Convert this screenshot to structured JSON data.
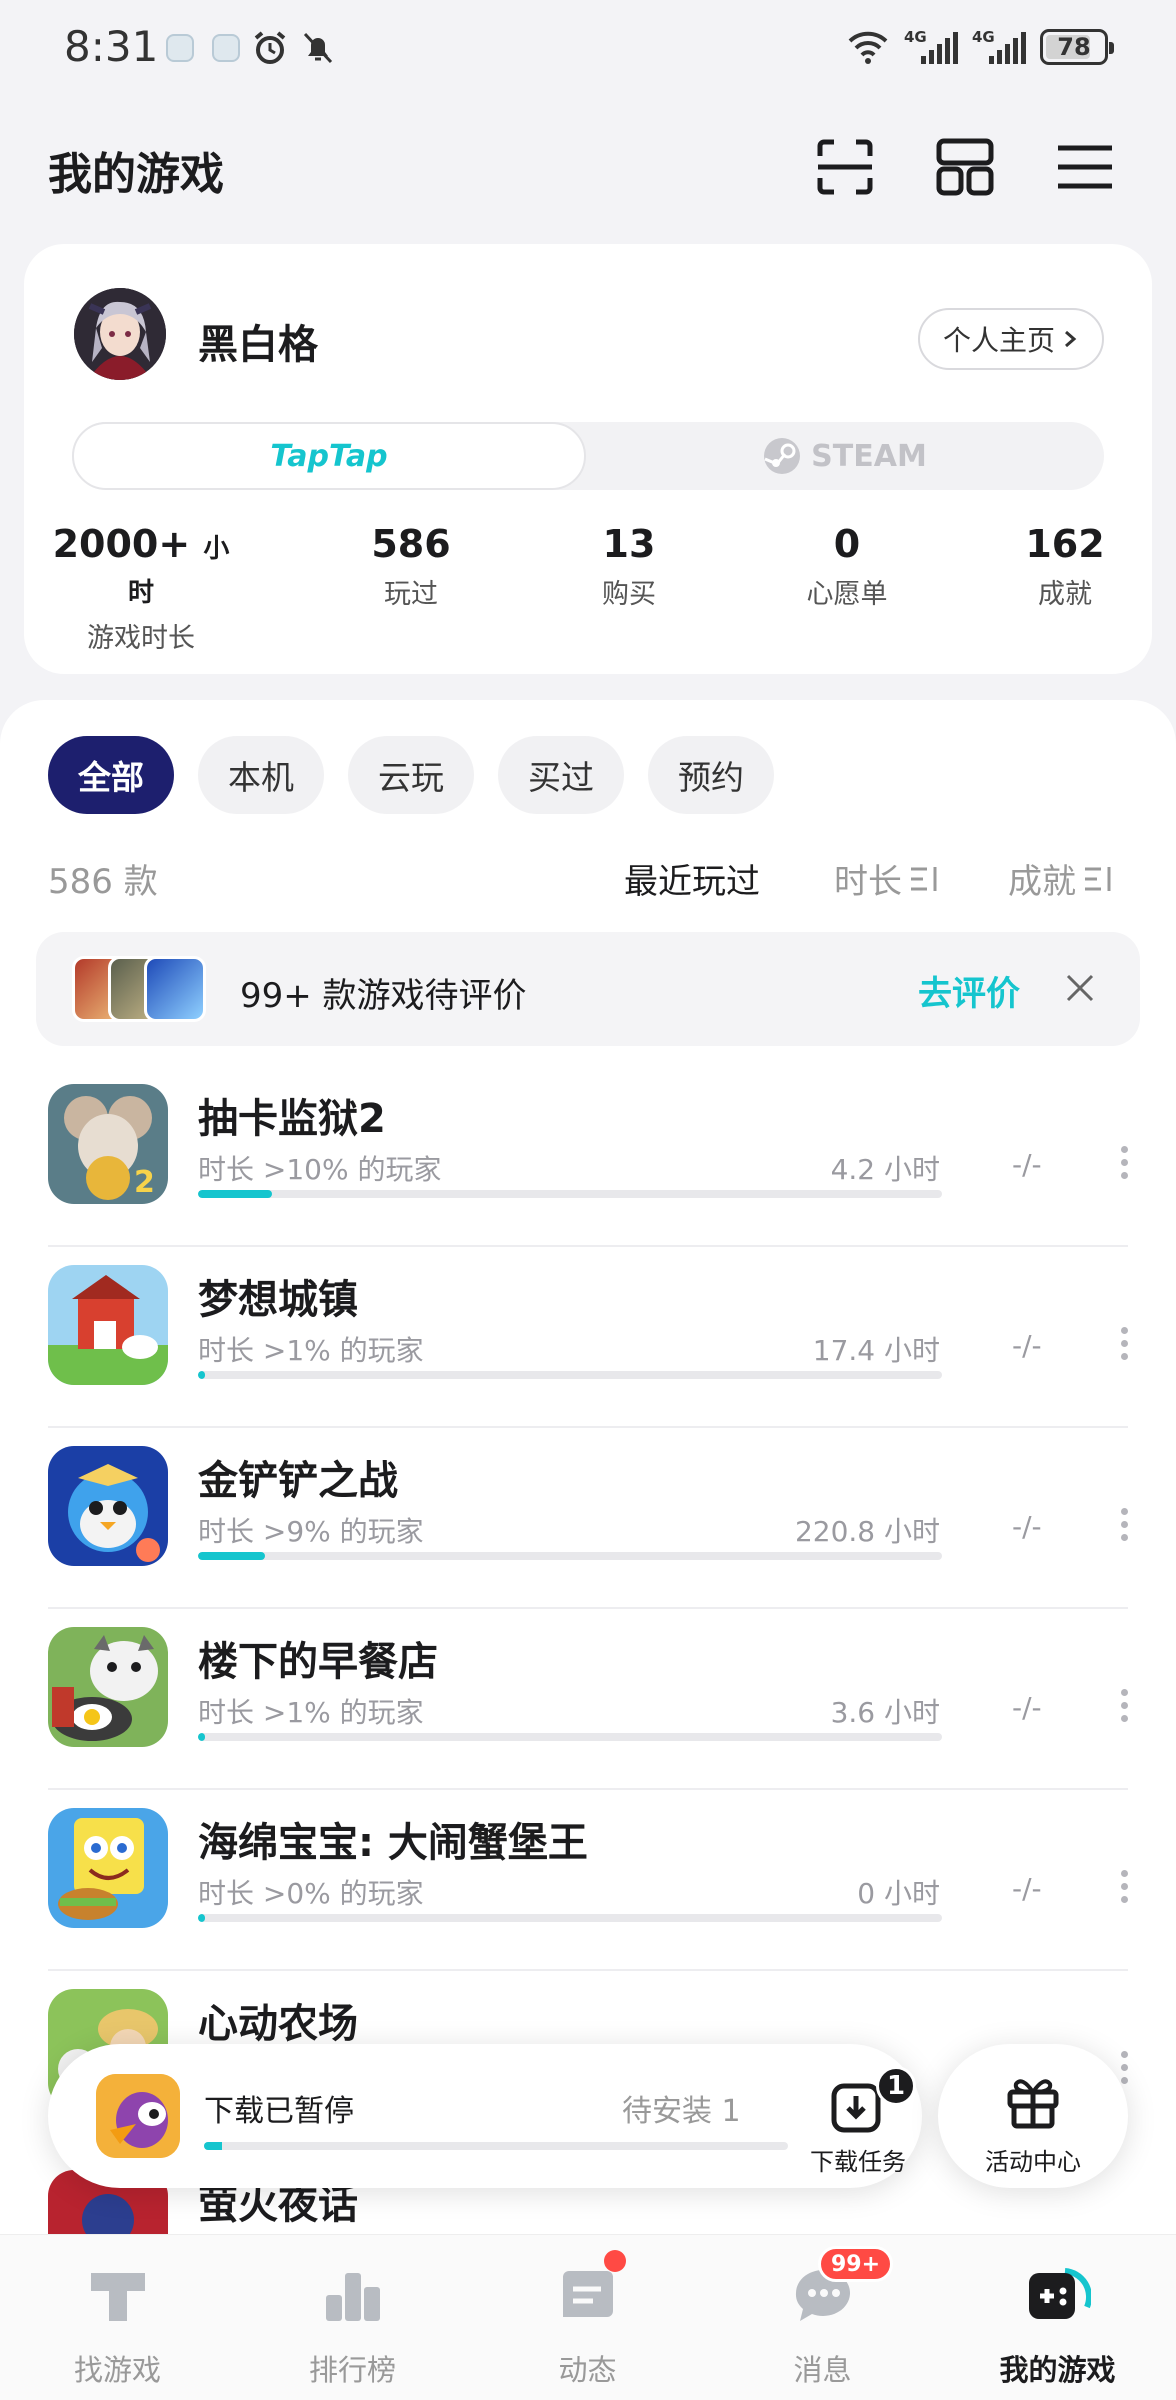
{
  "status_bar": {
    "time": "8:31",
    "network_1": "4G",
    "network_2": "4G",
    "battery": "78",
    "icons": [
      "app-notification-icon",
      "app-notification-icon",
      "alarm-icon",
      "mute-icon",
      "wifi-icon",
      "signal-icon",
      "battery-icon"
    ]
  },
  "header": {
    "title": "我的游戏",
    "icons": [
      "scan-icon",
      "layout-icon",
      "menu-icon"
    ]
  },
  "profile": {
    "username": "黑白格",
    "homepage_label": "个人主页",
    "platforms": [
      "TapTap",
      "STEAM"
    ],
    "active_platform": "TapTap",
    "stats": [
      {
        "value": "2000+",
        "unit": "小时",
        "label": "游戏时长"
      },
      {
        "value": "586",
        "unit": "",
        "label": "玩过"
      },
      {
        "value": "13",
        "unit": "",
        "label": "购买"
      },
      {
        "value": "0",
        "unit": "",
        "label": "心愿单"
      },
      {
        "value": "162",
        "unit": "",
        "label": "成就"
      }
    ]
  },
  "filters": {
    "chips": [
      "全部",
      "本机",
      "云玩",
      "买过",
      "预约"
    ],
    "active": "全部"
  },
  "sort": {
    "count": "586 款",
    "options": [
      "最近玩过",
      "时长",
      "成就"
    ],
    "active": "最近玩过"
  },
  "review_banner": {
    "text": "99+ 款游戏待评价",
    "action": "去评价"
  },
  "games": [
    {
      "name": "抽卡监狱2",
      "rank": "时长 >10% 的玩家",
      "hours": "4.2 小时",
      "progress": 0.1,
      "score": "-/-"
    },
    {
      "name": "梦想城镇",
      "rank": "时长 >1% 的玩家",
      "hours": "17.4 小时",
      "progress": 0.01,
      "score": "-/-"
    },
    {
      "name": "金铲铲之战",
      "rank": "时长 >9% 的玩家",
      "hours": "220.8 小时",
      "progress": 0.09,
      "score": "-/-"
    },
    {
      "name": "楼下的早餐店",
      "rank": "时长 >1% 的玩家",
      "hours": "3.6 小时",
      "progress": 0.01,
      "score": "-/-"
    },
    {
      "name": "海绵宝宝: 大闹蟹堡王",
      "rank": "时长 >0% 的玩家",
      "hours": "0 小时",
      "progress": 0.0,
      "score": "-/-"
    },
    {
      "name": "心动农场",
      "rank": "",
      "hours": "",
      "progress": 0.0,
      "score": ""
    },
    {
      "name": "萤火夜话",
      "rank": "",
      "hours": "",
      "progress": 0.0,
      "score": ""
    }
  ],
  "download": {
    "title": "下载已暂停",
    "pending": "待安装 1",
    "task_label": "下载任务",
    "task_badge": "1",
    "progress": 0.03
  },
  "activity": {
    "label": "活动中心"
  },
  "bottom_nav": {
    "items": [
      "找游戏",
      "排行榜",
      "动态",
      "消息",
      "我的游戏"
    ],
    "active": "我的游戏",
    "message_badge": "99+"
  },
  "colors": {
    "accent": "#15c5ce",
    "active_chip": "#1d1f6e",
    "badge": "#ff4a44"
  }
}
